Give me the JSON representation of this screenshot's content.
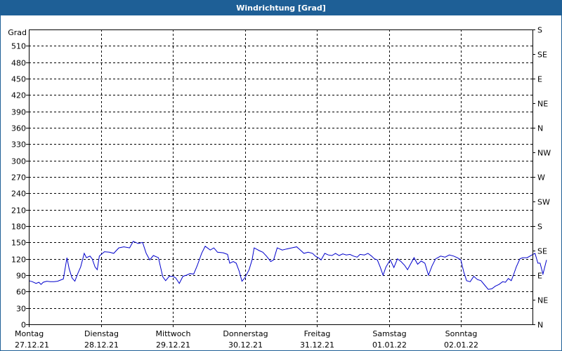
{
  "title": "Windrichtung [Grad]",
  "colors": {
    "header_bg": "#1e5f96",
    "header_text": "#ffffff",
    "line": "#0000cc",
    "grid": "#000000"
  },
  "chart_data": {
    "type": "line",
    "title": "Windrichtung [Grad]",
    "ylabel": "Grad",
    "ylim": [
      0,
      540
    ],
    "yticks": [
      0,
      30,
      60,
      90,
      120,
      150,
      180,
      210,
      240,
      270,
      300,
      330,
      360,
      390,
      420,
      450,
      480,
      510
    ],
    "y2_ticks": [
      {
        "value": 0,
        "label": "N"
      },
      {
        "value": 45,
        "label": "NE"
      },
      {
        "value": 90,
        "label": "E"
      },
      {
        "value": 135,
        "label": "SE"
      },
      {
        "value": 180,
        "label": "S"
      },
      {
        "value": 225,
        "label": "SW"
      },
      {
        "value": 270,
        "label": "W"
      },
      {
        "value": 315,
        "label": "NW"
      },
      {
        "value": 360,
        "label": "N"
      },
      {
        "value": 405,
        "label": "NE"
      },
      {
        "value": 450,
        "label": "E"
      },
      {
        "value": 495,
        "label": "SE"
      },
      {
        "value": 540,
        "label": "S"
      }
    ],
    "xlim": [
      0,
      7
    ],
    "x_ticks": [
      {
        "x": 0,
        "day": "Montag",
        "date": "27.12.21"
      },
      {
        "x": 1,
        "day": "Dienstag",
        "date": "28.12.21"
      },
      {
        "x": 2,
        "day": "Mittwoch",
        "date": "29.12.21"
      },
      {
        "x": 3,
        "day": "Donnerstag",
        "date": "30.12.21"
      },
      {
        "x": 4,
        "day": "Freitag",
        "date": "31.12.21"
      },
      {
        "x": 5,
        "day": "Samstag",
        "date": "01.01.22"
      },
      {
        "x": 6,
        "day": "Sonntag",
        "date": "02.01.22"
      }
    ],
    "grid": true,
    "series": [
      {
        "color": "#0000cc",
        "points": [
          [
            0.0,
            80
          ],
          [
            0.05,
            78
          ],
          [
            0.1,
            75
          ],
          [
            0.14,
            77
          ],
          [
            0.17,
            73
          ],
          [
            0.2,
            77
          ],
          [
            0.25,
            79
          ],
          [
            0.3,
            78
          ],
          [
            0.35,
            78
          ],
          [
            0.4,
            79
          ],
          [
            0.48,
            83
          ],
          [
            0.53,
            122
          ],
          [
            0.56,
            102
          ],
          [
            0.6,
            85
          ],
          [
            0.64,
            79
          ],
          [
            0.68,
            93
          ],
          [
            0.72,
            105
          ],
          [
            0.77,
            130
          ],
          [
            0.8,
            122
          ],
          [
            0.85,
            125
          ],
          [
            0.88,
            120
          ],
          [
            0.92,
            105
          ],
          [
            0.95,
            100
          ],
          [
            0.98,
            125
          ],
          [
            1.05,
            133
          ],
          [
            1.12,
            132
          ],
          [
            1.18,
            130
          ],
          [
            1.25,
            140
          ],
          [
            1.32,
            142
          ],
          [
            1.4,
            140
          ],
          [
            1.45,
            152
          ],
          [
            1.52,
            148
          ],
          [
            1.58,
            150
          ],
          [
            1.63,
            130
          ],
          [
            1.68,
            118
          ],
          [
            1.73,
            126
          ],
          [
            1.8,
            122
          ],
          [
            1.86,
            87
          ],
          [
            1.9,
            80
          ],
          [
            1.95,
            88
          ],
          [
            2.0,
            88
          ],
          [
            2.04,
            85
          ],
          [
            2.09,
            75
          ],
          [
            2.14,
            88
          ],
          [
            2.19,
            90
          ],
          [
            2.24,
            93
          ],
          [
            2.29,
            92
          ],
          [
            2.34,
            108
          ],
          [
            2.4,
            130
          ],
          [
            2.45,
            143
          ],
          [
            2.52,
            136
          ],
          [
            2.57,
            140
          ],
          [
            2.62,
            132
          ],
          [
            2.7,
            131
          ],
          [
            2.76,
            128
          ],
          [
            2.79,
            112
          ],
          [
            2.84,
            115
          ],
          [
            2.88,
            112
          ],
          [
            2.92,
            98
          ],
          [
            2.96,
            79
          ],
          [
            3.0,
            85
          ],
          [
            3.06,
            100
          ],
          [
            3.1,
            118
          ],
          [
            3.13,
            140
          ],
          [
            3.2,
            135
          ],
          [
            3.25,
            132
          ],
          [
            3.3,
            125
          ],
          [
            3.36,
            115
          ],
          [
            3.4,
            118
          ],
          [
            3.45,
            140
          ],
          [
            3.52,
            136
          ],
          [
            3.58,
            138
          ],
          [
            3.65,
            140
          ],
          [
            3.72,
            142
          ],
          [
            3.78,
            135
          ],
          [
            3.82,
            130
          ],
          [
            3.88,
            132
          ],
          [
            3.94,
            130
          ],
          [
            3.98,
            125
          ],
          [
            4.02,
            122
          ],
          [
            4.06,
            118
          ],
          [
            4.11,
            130
          ],
          [
            4.16,
            127
          ],
          [
            4.21,
            126
          ],
          [
            4.26,
            130
          ],
          [
            4.31,
            126
          ],
          [
            4.36,
            129
          ],
          [
            4.41,
            127
          ],
          [
            4.46,
            128
          ],
          [
            4.51,
            125
          ],
          [
            4.56,
            123
          ],
          [
            4.6,
            128
          ],
          [
            4.66,
            127
          ],
          [
            4.71,
            130
          ],
          [
            4.76,
            125
          ],
          [
            4.8,
            120
          ],
          [
            4.84,
            118
          ],
          [
            4.88,
            105
          ],
          [
            4.92,
            90
          ],
          [
            4.96,
            105
          ],
          [
            5.02,
            118
          ],
          [
            5.07,
            104
          ],
          [
            5.12,
            120
          ],
          [
            5.17,
            115
          ],
          [
            5.22,
            108
          ],
          [
            5.26,
            100
          ],
          [
            5.3,
            110
          ],
          [
            5.35,
            122
          ],
          [
            5.4,
            110
          ],
          [
            5.45,
            116
          ],
          [
            5.5,
            112
          ],
          [
            5.55,
            90
          ],
          [
            5.6,
            107
          ],
          [
            5.65,
            120
          ],
          [
            5.72,
            125
          ],
          [
            5.78,
            123
          ],
          [
            5.84,
            127
          ],
          [
            5.9,
            125
          ],
          [
            5.95,
            122
          ],
          [
            6.0,
            118
          ],
          [
            6.04,
            96
          ],
          [
            6.08,
            80
          ],
          [
            6.13,
            78
          ],
          [
            6.18,
            88
          ],
          [
            6.23,
            82
          ],
          [
            6.28,
            80
          ],
          [
            6.33,
            72
          ],
          [
            6.38,
            64
          ],
          [
            6.43,
            65
          ],
          [
            6.48,
            70
          ],
          [
            6.53,
            73
          ],
          [
            6.58,
            78
          ],
          [
            6.62,
            77
          ],
          [
            6.66,
            84
          ],
          [
            6.7,
            80
          ],
          [
            6.73,
            90
          ],
          [
            6.77,
            105
          ],
          [
            6.82,
            120
          ],
          [
            6.86,
            122
          ],
          [
            6.92,
            122
          ],
          [
            6.96,
            125
          ],
          [
            7.0,
            128
          ],
          [
            7.03,
            130
          ],
          [
            7.07,
            112
          ],
          [
            7.1,
            112
          ],
          [
            7.14,
            92
          ],
          [
            7.19,
            118
          ]
        ]
      }
    ]
  }
}
